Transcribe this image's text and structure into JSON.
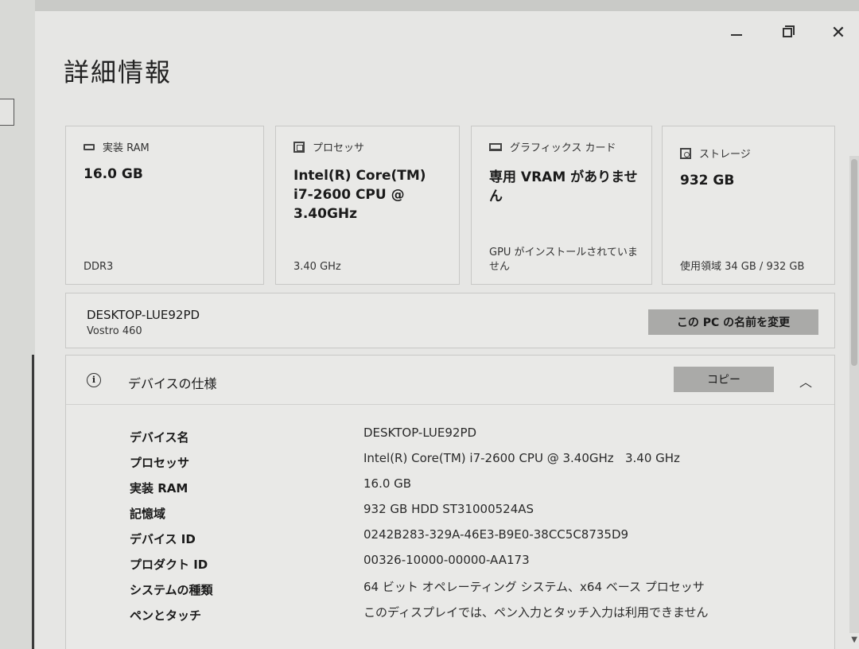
{
  "page": {
    "title": "詳細情報"
  },
  "window_controls": {
    "minimize_icon": "minimize-icon",
    "maximize_icon": "restore-icon",
    "close_glyph": "✕"
  },
  "cards": [
    {
      "icon": "ram-icon",
      "label": "実装 RAM",
      "value": "16.0 GB",
      "footer": "DDR3"
    },
    {
      "icon": "processor-icon",
      "label": "プロセッサ",
      "value": "Intel(R) Core(TM) i7-2600 CPU @ 3.40GHz",
      "footer": "3.40 GHz"
    },
    {
      "icon": "graphics-card-icon",
      "label": "グラフィックス カード",
      "value": "専用 VRAM がありません",
      "footer": "GPU がインストールされていません"
    },
    {
      "icon": "storage-icon",
      "label": "ストレージ",
      "value": "932 GB",
      "footer": "使用領域 34 GB / 932 GB"
    }
  ],
  "device": {
    "name": "DESKTOP-LUE92PD",
    "model": "Vostro 460",
    "rename_label": "この PC の名前を変更"
  },
  "specs": {
    "title": "デバイスの仕様",
    "info_glyph": "i",
    "copy_label": "コピー",
    "collapse_glyph": "︿",
    "rows": [
      {
        "label": "デバイス名",
        "value": "DESKTOP-LUE92PD"
      },
      {
        "label": "プロセッサ",
        "value": "Intel(R) Core(TM) i7-2600 CPU @ 3.40GHz   3.40 GHz"
      },
      {
        "label": "実装 RAM",
        "value": "16.0 GB"
      },
      {
        "label": "記憶域",
        "value": "932 GB HDD ST31000524AS"
      },
      {
        "label": "デバイス ID",
        "value": "0242B283-329A-46E3-B9E0-38CC5C8735D9"
      },
      {
        "label": "プロダクト ID",
        "value": "00326-10000-00000-AA173"
      },
      {
        "label": "システムの種類",
        "value": "64 ビット オペレーティング システム、x64 ベース プロセッサ"
      },
      {
        "label": "ペンとタッチ",
        "value": "このディスプレイでは、ペン入力とタッチ入力は利用できません"
      }
    ]
  }
}
